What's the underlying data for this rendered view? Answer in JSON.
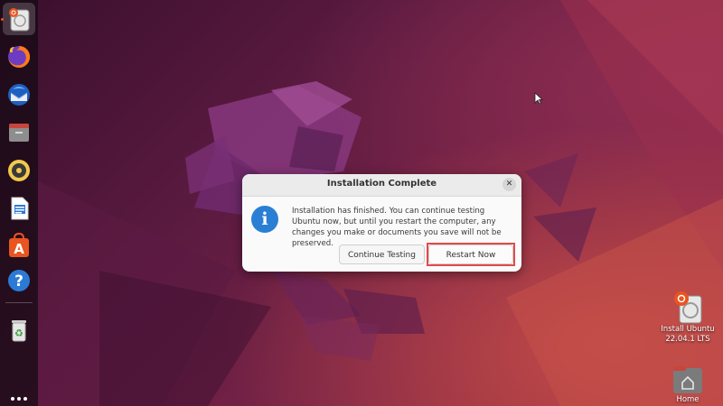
{
  "dialog": {
    "title": "Installation Complete",
    "close_symbol": "✕",
    "icon": "info-icon",
    "icon_glyph": "i",
    "message": "Installation has finished.  You can continue testing Ubuntu now, but until you restart the computer, any changes you make or documents you save will not be preserved.",
    "buttons": {
      "continue": "Continue Testing",
      "restart": "Restart Now"
    }
  },
  "dock": {
    "items": [
      {
        "name": "install-ubuntu-icon",
        "active": true
      },
      {
        "name": "firefox-icon"
      },
      {
        "name": "thunderbird-icon"
      },
      {
        "name": "files-icon"
      },
      {
        "name": "rhythmbox-icon"
      },
      {
        "name": "libreoffice-writer-icon"
      },
      {
        "name": "ubuntu-software-icon",
        "glyph": "A"
      },
      {
        "name": "help-icon",
        "glyph": "?"
      },
      {
        "name": "trash-icon",
        "glyph": "♻"
      }
    ],
    "show_apps": "apps-grid-icon"
  },
  "desktop": {
    "install_label_line1": "Install Ubuntu",
    "install_label_line2": "22.04.1 LTS",
    "home_label": "Home"
  },
  "colors": {
    "ubuntu_orange": "#e95420",
    "info_blue": "#2a7fd4",
    "highlight_red": "#e24a4a"
  }
}
